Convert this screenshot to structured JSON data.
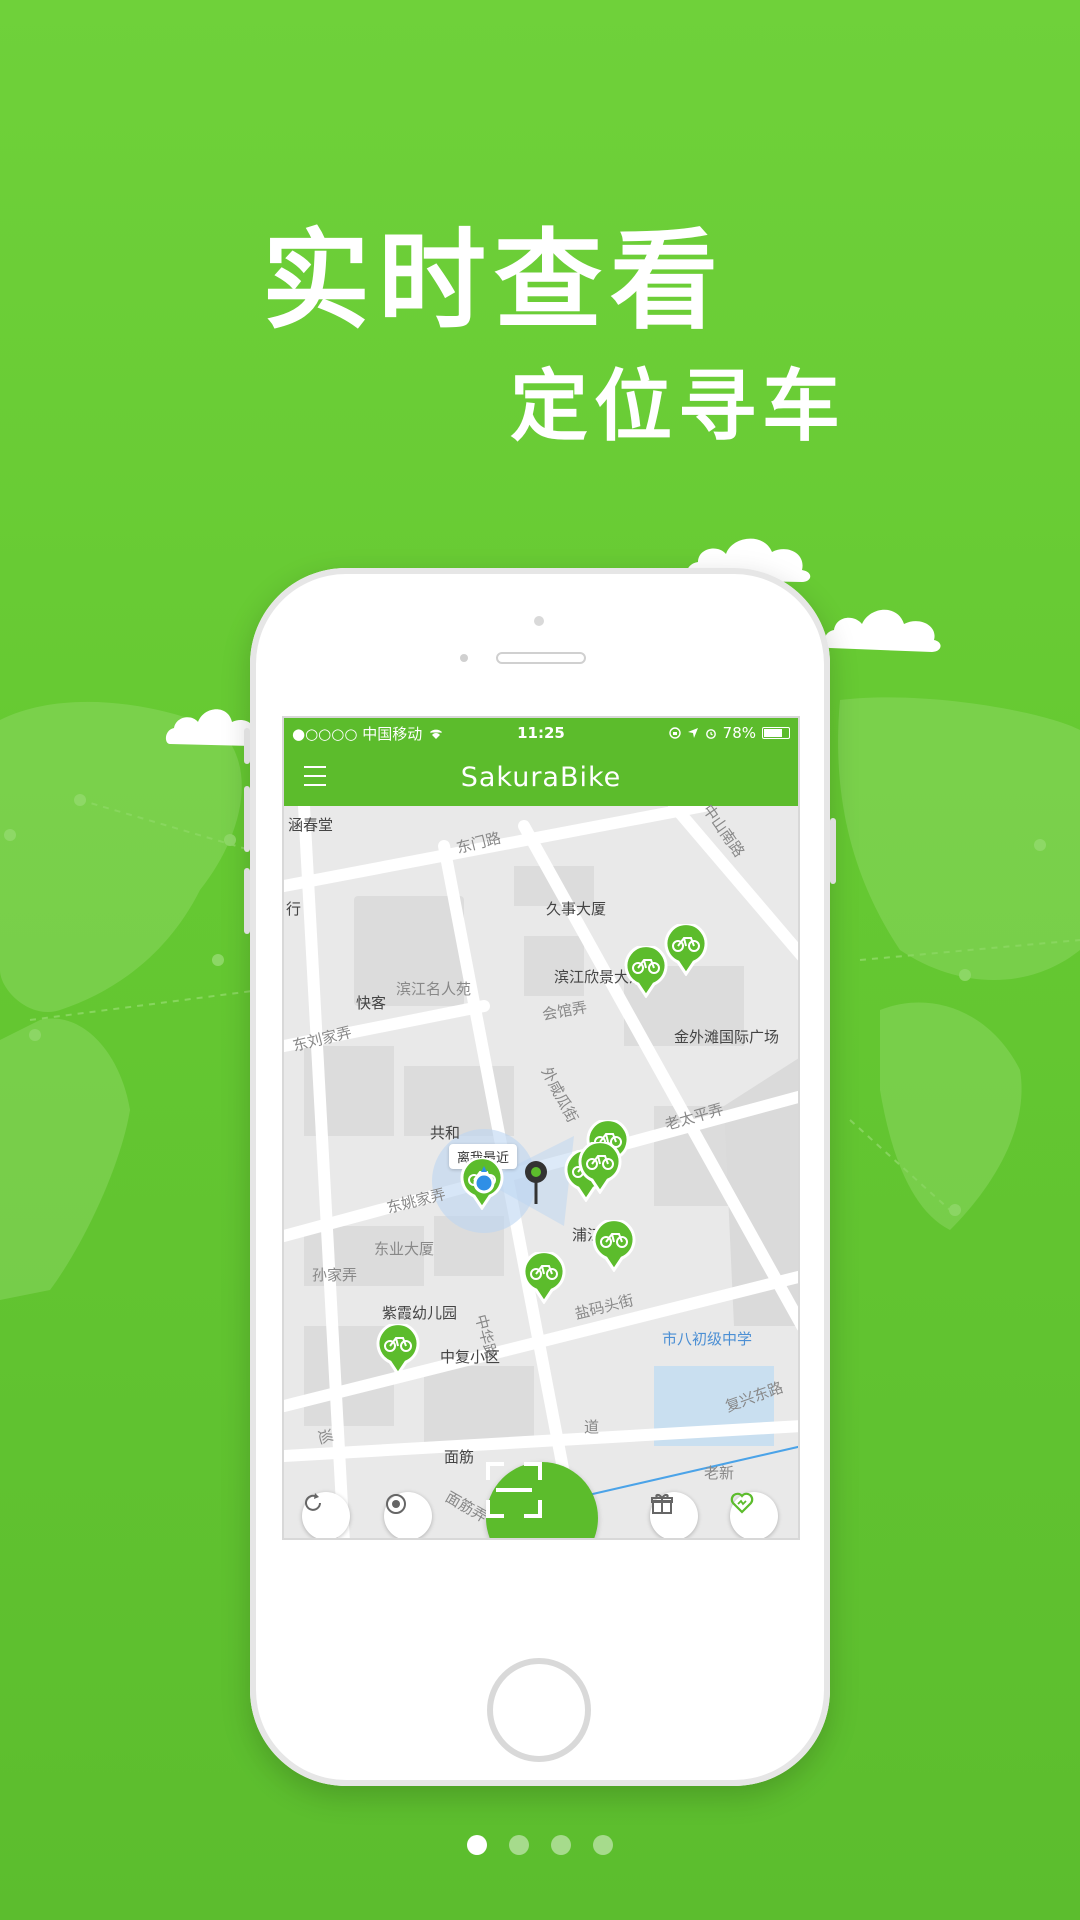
{
  "promo": {
    "headline": "实时查看",
    "subline": "定位寻车"
  },
  "status_bar": {
    "carrier": "●○○○○ 中国移动",
    "time": "11:25",
    "battery": "78%"
  },
  "nav": {
    "title": "SakuraBike"
  },
  "map": {
    "nearest_tip": "离我最近",
    "labels": [
      "涵春堂",
      "东门路",
      "中山南路",
      "久事大厦",
      "行",
      "滨江名人苑",
      "滨江欣景大酒店",
      "快客",
      "会馆弄",
      "东刘家弄",
      "金外滩国际广场",
      "外咸瓜街",
      "老太平弄",
      "共和",
      "东姚家弄",
      "浦江公馆",
      "东业大厦",
      "孙家弄",
      "紫霞幼儿园",
      "盐码头街",
      "中华路",
      "市八初级中学",
      "中复小区",
      "复兴东路",
      "面筋",
      "面筋弄",
      "老新",
      "巡",
      "道"
    ]
  },
  "colors": {
    "brand_green": "#5cbc2c",
    "bg_green": "#66c932",
    "location_blue": "#2f8fe6"
  },
  "icons": {
    "refresh": "refresh-icon",
    "locate": "locate-icon",
    "scan": "scan-icon",
    "gift": "gift-icon",
    "favorite": "heart-icon"
  },
  "pager": {
    "pages": 4,
    "current": 1
  }
}
